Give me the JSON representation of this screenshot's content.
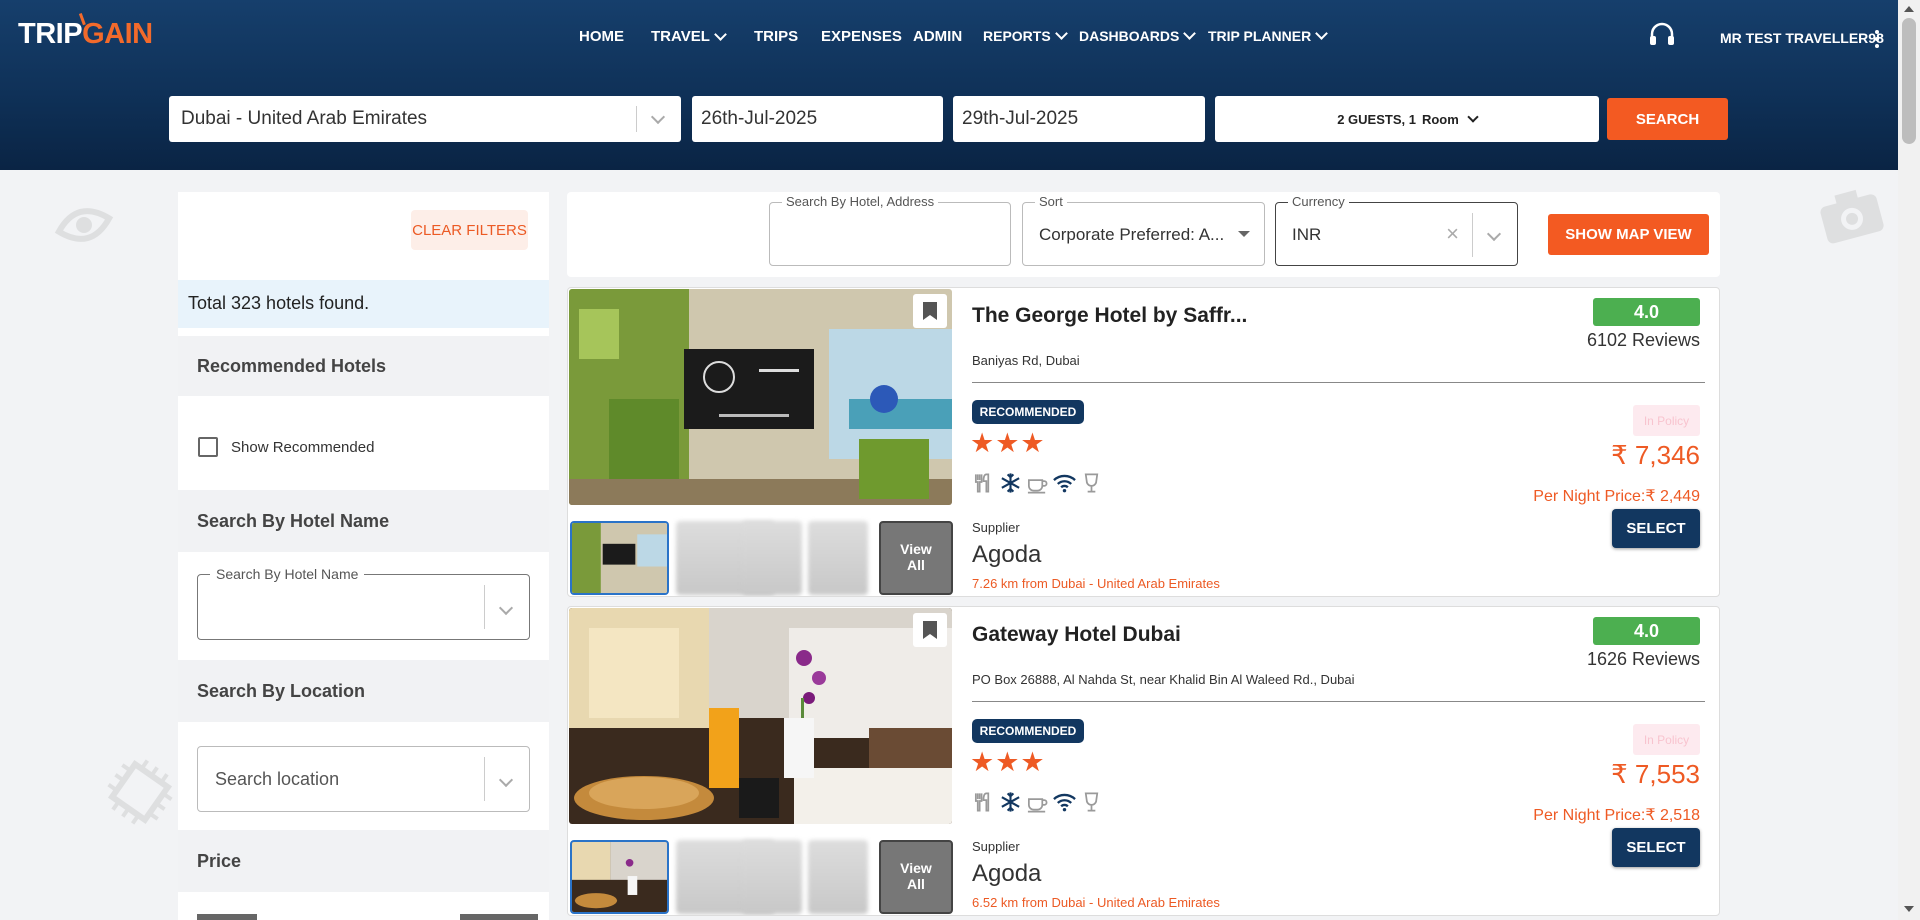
{
  "brand": {
    "logo_trip": "TRIP",
    "logo_gain": "GAIN",
    "accent": "#f35a22",
    "navy": "#123760"
  },
  "nav": {
    "home": "HOME",
    "travel": "TRAVEL",
    "trips": "TRIPS",
    "expenses": "EXPENSES",
    "admin": "ADMIN",
    "reports": "REPORTS",
    "dashboards": "DASHBOARDS",
    "trip_planner": "TRIP PLANNER",
    "user": "MR TEST TRAVELLER98"
  },
  "search": {
    "destination": "Dubai - United Arab Emirates",
    "check_in": "26th-Jul-2025",
    "check_out": "29th-Jul-2025",
    "guests": "2 GUESTS, 1",
    "room": "Room",
    "button": "SEARCH"
  },
  "sidebar": {
    "clear_filters": "CLEAR FILTERS",
    "total": "Total 323 hotels found.",
    "recommended_heading": "Recommended Hotels",
    "show_recommended": "Show Recommended",
    "show_recommended_checked": false,
    "hotel_name_heading": "Search By Hotel Name",
    "hotel_name_legend": "Search By Hotel Name",
    "location_heading": "Search By Location",
    "location_placeholder": "Search location",
    "price_heading": "Price"
  },
  "toolbar": {
    "search_legend": "Search By Hotel, Address",
    "search_value": "",
    "sort_legend": "Sort",
    "sort_value": "Corporate Preferred: A...",
    "currency_legend": "Currency",
    "currency_value": "INR",
    "map_button": "SHOW MAP VIEW"
  },
  "hotels": [
    {
      "name": "The George Hotel by Saffr...",
      "address": "Baniyas Rd, Dubai",
      "rating": "4.0",
      "reviews": "6102 Reviews",
      "badge": "RECOMMENDED",
      "stars": "★★★",
      "star_count": 3,
      "amenities": [
        "restaurant-icon",
        "ac-snowflake-icon",
        "coffee-icon",
        "wifi-icon",
        "bar-icon"
      ],
      "supplier_label": "Supplier",
      "supplier": "Agoda",
      "distance": "7.26 km from Dubai - United Arab Emirates",
      "policy": "In Policy",
      "price": "₹ 7,346",
      "per_night": "Per Night Price:₹ 2,449",
      "select": "SELECT",
      "view_all": "View All"
    },
    {
      "name": "Gateway Hotel Dubai",
      "address": "PO Box 26888, Al Nahda St, near Khalid Bin Al Waleed Rd., Dubai",
      "rating": "4.0",
      "reviews": "1626 Reviews",
      "badge": "RECOMMENDED",
      "stars": "★★★",
      "star_count": 3,
      "amenities": [
        "restaurant-icon",
        "ac-snowflake-icon",
        "coffee-icon",
        "wifi-icon",
        "bar-icon"
      ],
      "supplier_label": "Supplier",
      "supplier": "Agoda",
      "distance": "6.52 km from Dubai - United Arab Emirates",
      "policy": "In Policy",
      "price": "₹ 7,553",
      "per_night": "Per Night Price:₹ 2,518",
      "select": "SELECT",
      "view_all": "View All"
    }
  ]
}
